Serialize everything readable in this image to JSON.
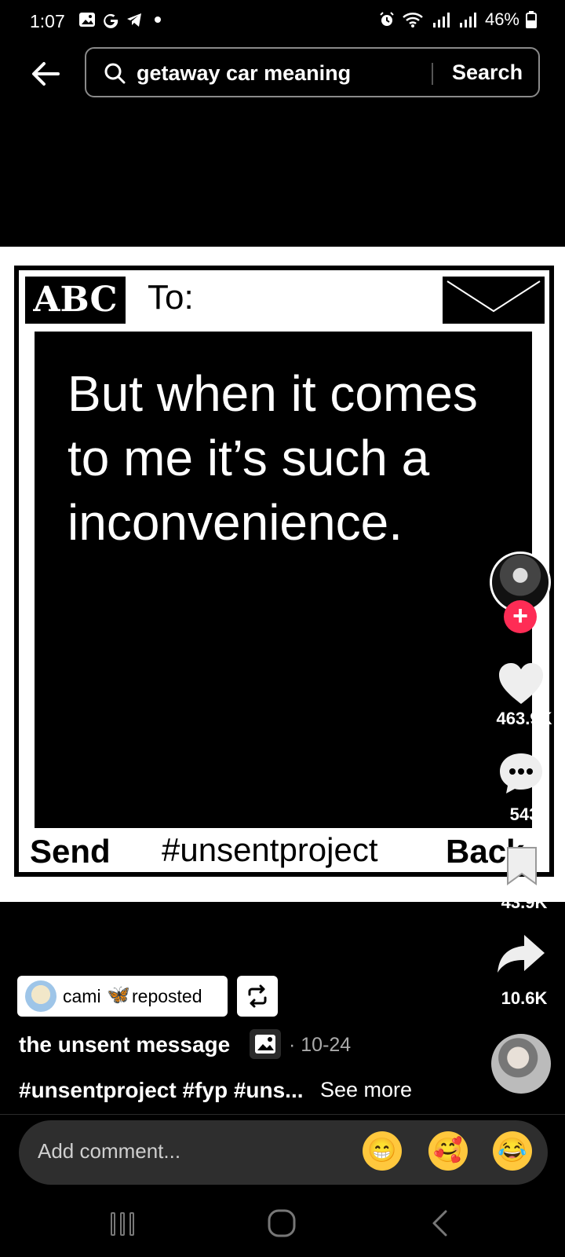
{
  "status_bar": {
    "time": "1:07",
    "battery": "46%",
    "icons": [
      "image-icon",
      "google-icon",
      "telegram-icon",
      "dot-icon",
      "alarm-icon",
      "wifi-icon",
      "signal-icon",
      "signal-icon",
      "battery-icon"
    ]
  },
  "search": {
    "query": "getaway car meaning",
    "button_label": "Search"
  },
  "video": {
    "logo": "ABC",
    "to_label": "To:",
    "message": "But when it comes to me it’s such a inconvenience.",
    "send_label": "Send",
    "hashtag_label": "#unsentproject",
    "back_label": "Back"
  },
  "actions": {
    "likes": "463.9K",
    "comments": "543",
    "saves": "43.9K",
    "shares": "10.6K"
  },
  "caption": {
    "repost_user": "cami",
    "repost_emoji": "🦋",
    "repost_label": "reposted",
    "title": "the unsent message",
    "date": "· 10-24",
    "hashtags": "#unsentproject #fyp #uns...",
    "see_more": "See more"
  },
  "comment_bar": {
    "placeholder": "Add comment...",
    "emojis": [
      "😁",
      "🥰",
      "😂"
    ]
  },
  "colors": {
    "accent": "#fe2c55",
    "background": "#000000"
  }
}
